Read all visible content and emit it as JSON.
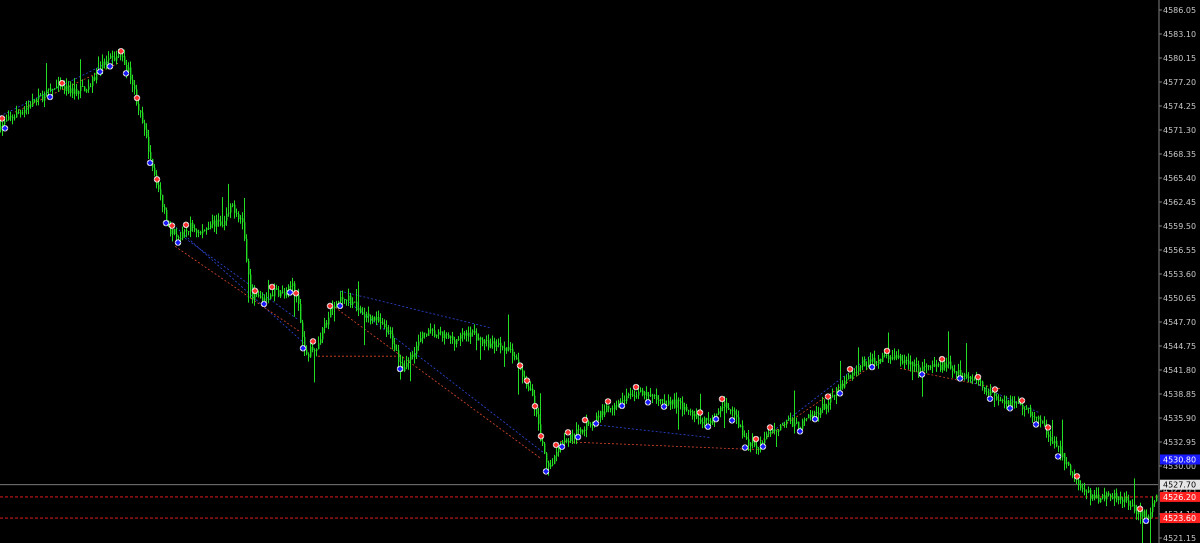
{
  "chart_data": {
    "type": "candlestick",
    "title": "",
    "xlabel": "",
    "ylabel": "",
    "ylim": [
      4521.15,
      4586.05
    ],
    "y_ticks": [
      "4586.05",
      "4583.10",
      "4580.15",
      "4577.20",
      "4574.25",
      "4571.30",
      "4568.35",
      "4565.40",
      "4562.45",
      "4559.50",
      "4556.55",
      "4553.60",
      "4550.65",
      "4547.70",
      "4544.75",
      "4541.80",
      "4538.85",
      "4535.90",
      "4532.95",
      "4530.00",
      "4527.05",
      "4524.10",
      "4521.15"
    ],
    "grid": false,
    "current_price": "4527.70",
    "tags": [
      {
        "price": 4530.8,
        "label": "4530.80",
        "color": "#1a1aff",
        "role": "upper-level"
      },
      {
        "price": 4526.2,
        "label": "4526.20",
        "color": "#ff2020",
        "role": "level-1"
      },
      {
        "price": 4523.6,
        "label": "4523.60",
        "color": "#ff2020",
        "role": "level-2"
      }
    ],
    "price_path": [
      [
        0,
        4571.8
      ],
      [
        30,
        4574.5
      ],
      [
        55,
        4576.5
      ],
      [
        75,
        4576.0
      ],
      [
        90,
        4576.8
      ],
      [
        100,
        4579.2
      ],
      [
        112,
        4580.0
      ],
      [
        120,
        4580.5
      ],
      [
        130,
        4578.0
      ],
      [
        140,
        4573.0
      ],
      [
        150,
        4568.0
      ],
      [
        160,
        4563.0
      ],
      [
        170,
        4559.0
      ],
      [
        180,
        4558.0
      ],
      [
        190,
        4559.5
      ],
      [
        200,
        4558.5
      ],
      [
        210,
        4560.0
      ],
      [
        222,
        4559.5
      ],
      [
        232,
        4562.0
      ],
      [
        242,
        4560.0
      ],
      [
        250,
        4551.0
      ],
      [
        262,
        4550.5
      ],
      [
        275,
        4551.5
      ],
      [
        285,
        4551.0
      ],
      [
        292,
        4552.5
      ],
      [
        298,
        4549.5
      ],
      [
        305,
        4543.5
      ],
      [
        312,
        4544.5
      ],
      [
        318,
        4545.0
      ],
      [
        325,
        4547.5
      ],
      [
        332,
        4549.5
      ],
      [
        345,
        4551.0
      ],
      [
        360,
        4549.0
      ],
      [
        375,
        4548.0
      ],
      [
        390,
        4546.0
      ],
      [
        402,
        4542.0
      ],
      [
        410,
        4543.5
      ],
      [
        425,
        4546.5
      ],
      [
        440,
        4546.0
      ],
      [
        455,
        4545.5
      ],
      [
        470,
        4546.5
      ],
      [
        485,
        4545.0
      ],
      [
        500,
        4545.0
      ],
      [
        512,
        4544.0
      ],
      [
        522,
        4541.0
      ],
      [
        532,
        4538.5
      ],
      [
        540,
        4533.5
      ],
      [
        547,
        4529.5
      ],
      [
        553,
        4531.0
      ],
      [
        560,
        4533.0
      ],
      [
        570,
        4533.5
      ],
      [
        580,
        4534.5
      ],
      [
        592,
        4535.5
      ],
      [
        605,
        4537.0
      ],
      [
        620,
        4538.0
      ],
      [
        635,
        4539.0
      ],
      [
        650,
        4538.5
      ],
      [
        665,
        4538.0
      ],
      [
        680,
        4537.5
      ],
      [
        695,
        4536.0
      ],
      [
        710,
        4535.5
      ],
      [
        722,
        4537.5
      ],
      [
        735,
        4536.0
      ],
      [
        745,
        4533.0
      ],
      [
        758,
        4532.5
      ],
      [
        770,
        4534.0
      ],
      [
        785,
        4535.5
      ],
      [
        800,
        4535.0
      ],
      [
        815,
        4536.5
      ],
      [
        830,
        4538.0
      ],
      [
        845,
        4540.5
      ],
      [
        860,
        4542.5
      ],
      [
        875,
        4543.0
      ],
      [
        890,
        4543.5
      ],
      [
        902,
        4543.0
      ],
      [
        915,
        4542.0
      ],
      [
        930,
        4542.0
      ],
      [
        945,
        4542.5
      ],
      [
        960,
        4541.5
      ],
      [
        975,
        4540.5
      ],
      [
        990,
        4539.0
      ],
      [
        1005,
        4538.0
      ],
      [
        1020,
        4537.5
      ],
      [
        1035,
        4536.0
      ],
      [
        1048,
        4534.0
      ],
      [
        1060,
        4531.5
      ],
      [
        1072,
        4529.0
      ],
      [
        1082,
        4527.0
      ],
      [
        1095,
        4526.0
      ],
      [
        1110,
        4526.5
      ],
      [
        1125,
        4526.0
      ],
      [
        1140,
        4524.0
      ],
      [
        1150,
        4524.0
      ],
      [
        1158,
        4527.7
      ]
    ],
    "signals": [
      {
        "x": 2,
        "type": "sell"
      },
      {
        "x": 5,
        "type": "buy"
      },
      {
        "x": 50,
        "type": "buy"
      },
      {
        "x": 62,
        "type": "sell"
      },
      {
        "x": 100,
        "type": "buy"
      },
      {
        "x": 110,
        "type": "buy"
      },
      {
        "x": 121,
        "type": "sell"
      },
      {
        "x": 126,
        "type": "buy"
      },
      {
        "x": 137,
        "type": "sell"
      },
      {
        "x": 150,
        "type": "buy"
      },
      {
        "x": 157,
        "type": "sell"
      },
      {
        "x": 166,
        "type": "buy"
      },
      {
        "x": 172,
        "type": "sell"
      },
      {
        "x": 178,
        "type": "buy"
      },
      {
        "x": 186,
        "type": "sell"
      },
      {
        "x": 255,
        "type": "sell"
      },
      {
        "x": 264,
        "type": "buy"
      },
      {
        "x": 272,
        "type": "sell"
      },
      {
        "x": 290,
        "type": "buy"
      },
      {
        "x": 296,
        "type": "sell"
      },
      {
        "x": 303,
        "type": "buy"
      },
      {
        "x": 313,
        "type": "sell"
      },
      {
        "x": 330,
        "type": "sell"
      },
      {
        "x": 340,
        "type": "buy"
      },
      {
        "x": 400,
        "type": "buy"
      },
      {
        "x": 520,
        "type": "sell"
      },
      {
        "x": 527,
        "type": "sell"
      },
      {
        "x": 535,
        "type": "sell"
      },
      {
        "x": 541,
        "type": "sell"
      },
      {
        "x": 546,
        "type": "buy"
      },
      {
        "x": 556,
        "type": "sell"
      },
      {
        "x": 562,
        "type": "buy"
      },
      {
        "x": 568,
        "type": "sell"
      },
      {
        "x": 578,
        "type": "buy"
      },
      {
        "x": 585,
        "type": "sell"
      },
      {
        "x": 596,
        "type": "buy"
      },
      {
        "x": 608,
        "type": "sell"
      },
      {
        "x": 622,
        "type": "buy"
      },
      {
        "x": 636,
        "type": "sell"
      },
      {
        "x": 648,
        "type": "buy"
      },
      {
        "x": 664,
        "type": "buy"
      },
      {
        "x": 700,
        "type": "sell"
      },
      {
        "x": 708,
        "type": "buy"
      },
      {
        "x": 716,
        "type": "buy"
      },
      {
        "x": 722,
        "type": "sell"
      },
      {
        "x": 732,
        "type": "buy"
      },
      {
        "x": 745,
        "type": "buy"
      },
      {
        "x": 756,
        "type": "sell"
      },
      {
        "x": 763,
        "type": "buy"
      },
      {
        "x": 770,
        "type": "sell"
      },
      {
        "x": 800,
        "type": "buy"
      },
      {
        "x": 815,
        "type": "buy"
      },
      {
        "x": 828,
        "type": "sell"
      },
      {
        "x": 840,
        "type": "buy"
      },
      {
        "x": 850,
        "type": "sell"
      },
      {
        "x": 872,
        "type": "buy"
      },
      {
        "x": 887,
        "type": "sell"
      },
      {
        "x": 922,
        "type": "buy"
      },
      {
        "x": 942,
        "type": "sell"
      },
      {
        "x": 960,
        "type": "buy"
      },
      {
        "x": 978,
        "type": "sell"
      },
      {
        "x": 990,
        "type": "buy"
      },
      {
        "x": 995,
        "type": "sell"
      },
      {
        "x": 1010,
        "type": "buy"
      },
      {
        "x": 1022,
        "type": "sell"
      },
      {
        "x": 1036,
        "type": "buy"
      },
      {
        "x": 1048,
        "type": "sell"
      },
      {
        "x": 1058,
        "type": "buy"
      },
      {
        "x": 1077,
        "type": "sell"
      },
      {
        "x": 1140,
        "type": "sell"
      },
      {
        "x": 1146,
        "type": "buy"
      }
    ],
    "trendlines": [
      {
        "from": [
          0,
          4573.0
        ],
        "to": [
          115,
          4580.0
        ],
        "color": "#3355ff"
      },
      {
        "from": [
          15,
          4573.5
        ],
        "to": [
          118,
          4579.5
        ],
        "color": "#ff5533"
      },
      {
        "from": [
          170,
          4560.0
        ],
        "to": [
          305,
          4545.0
        ],
        "color": "#3355ff"
      },
      {
        "from": [
          175,
          4557.0
        ],
        "to": [
          300,
          4546.5
        ],
        "color": "#ff5533"
      },
      {
        "from": [
          185,
          4558.0
        ],
        "to": [
          298,
          4548.0
        ],
        "color": "#3355ff"
      },
      {
        "from": [
          340,
          4551.5
        ],
        "to": [
          490,
          4547.0
        ],
        "color": "#3355ff"
      },
      {
        "from": [
          335,
          4549.5
        ],
        "to": [
          540,
          4531.0
        ],
        "color": "#ff5533"
      },
      {
        "from": [
          345,
          4550.5
        ],
        "to": [
          545,
          4531.5
        ],
        "color": "#3355ff"
      },
      {
        "from": [
          318,
          4543.5
        ],
        "to": [
          400,
          4543.5
        ],
        "color": "#ff5533"
      },
      {
        "from": [
          560,
          4533.0
        ],
        "to": [
          760,
          4532.0
        ],
        "color": "#ff5533"
      },
      {
        "from": [
          600,
          4535.0
        ],
        "to": [
          710,
          4533.5
        ],
        "color": "#3355ff"
      },
      {
        "from": [
          770,
          4534.0
        ],
        "to": [
          870,
          4543.5
        ],
        "color": "#3355ff"
      },
      {
        "from": [
          760,
          4533.0
        ],
        "to": [
          880,
          4543.0
        ],
        "color": "#ff5533"
      },
      {
        "from": [
          900,
          4542.0
        ],
        "to": [
          1000,
          4539.5
        ],
        "color": "#ff5533"
      },
      {
        "from": [
          960,
          4541.0
        ],
        "to": [
          1040,
          4536.5
        ],
        "color": "#3355ff"
      }
    ]
  },
  "colors": {
    "background": "#000000",
    "candle": "#22dd22",
    "axis": "#808080",
    "buy_arrow": "#1a1aff",
    "sell_arrow": "#ff3030",
    "current_line": "#8a8a8a"
  }
}
